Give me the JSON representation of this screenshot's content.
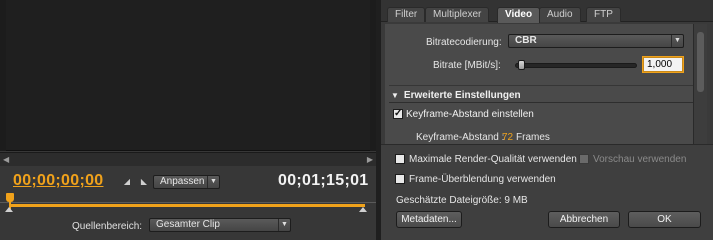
{
  "source_monitor": {
    "timecode_in": "00;00;00;00",
    "timecode_out": "00;01;15;01",
    "fit_dropdown": "Anpassen",
    "source_range_label": "Quellenbereich:",
    "source_range_value": "Gesamter Clip",
    "accent_color": "#f0a21b"
  },
  "export_panel": {
    "tabs": [
      {
        "label": "Filter",
        "active": false
      },
      {
        "label": "Multiplexer",
        "active": false
      },
      {
        "label": "Video",
        "active": true
      },
      {
        "label": "Audio",
        "active": false
      },
      {
        "label": "FTP",
        "active": false
      }
    ],
    "bitrate_encoding_label": "Bitratecodierung:",
    "bitrate_encoding_value": "CBR",
    "bitrate_label": "Bitrate [MBit/s]:",
    "bitrate_value": "1,000",
    "advanced_header": "Erweiterte Einstellungen",
    "keyframe_checkbox_label": "Keyframe-Abstand einstellen",
    "keyframe_checked": true,
    "keyframe_distance_label": "Keyframe-Abstand :",
    "keyframe_distance_value": "72",
    "keyframe_distance_unit": "Frames"
  },
  "bottom": {
    "max_render_quality_label": "Maximale Render-Qualität verwenden",
    "preview_label": "Vorschau verwenden",
    "frame_blending_label": "Frame-Überblendung verwenden",
    "estimated_size_label": "Geschätzte Dateigröße:",
    "estimated_size_value": "9 MB",
    "metadata_button": "Metadaten...",
    "cancel_button": "Abbrechen",
    "ok_button": "OK"
  }
}
